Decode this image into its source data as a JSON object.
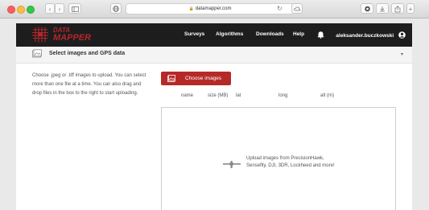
{
  "browser": {
    "url": "datamapper.com",
    "back_icon": "chevron-left-icon",
    "forward_icon": "chevron-right-icon"
  },
  "header": {
    "logo_line1": "DATA",
    "logo_line2": "MAPPER",
    "nav": [
      "Surveys",
      "Algorithms",
      "Downloads",
      "Help"
    ],
    "user": "aleksander.buczkowski"
  },
  "panel": {
    "title": "Select images and GPS data"
  },
  "instructions": {
    "line1": "Choose .jpeg or .tiff images to upload. You can select",
    "line2": "more than one file at a time. You can also drag and",
    "line3": "drop files in the box to the right to start uploading."
  },
  "upload": {
    "button_label": "Choose images",
    "columns": [
      "name",
      "size (MB)",
      "lat",
      "long",
      "alt (m)"
    ],
    "drop_line1": "Upload images from PrecisionHawk,",
    "drop_line2": "Senseflly, DJI, 3DR, Lockheed and more!"
  },
  "colors": {
    "brand_red": "#b52a27",
    "header_bg": "#1d1d1d"
  }
}
